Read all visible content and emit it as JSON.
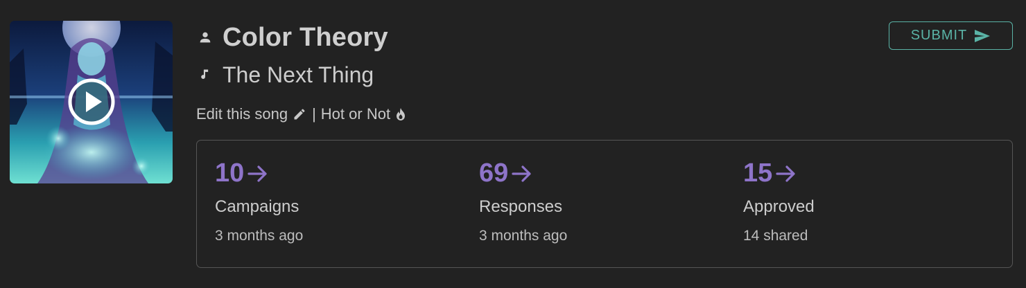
{
  "cover": {
    "alt_icon": "play-icon"
  },
  "artist": {
    "icon": "person-icon",
    "name": "Color Theory"
  },
  "song": {
    "icon": "music-note-icon",
    "title": "The Next Thing"
  },
  "links": {
    "edit_label": "Edit this song",
    "edit_icon": "pencil-icon",
    "separator": "|",
    "hot_label": "Hot or Not",
    "hot_icon": "flame-icon"
  },
  "submit": {
    "label": "SUBMIT",
    "icon": "send-icon"
  },
  "stats": [
    {
      "value": "10",
      "label": "Campaigns",
      "sub": "3 months ago"
    },
    {
      "value": "69",
      "label": "Responses",
      "sub": "3 months ago"
    },
    {
      "value": "15",
      "label": "Approved",
      "sub": "14 shared"
    }
  ],
  "colors": {
    "background": "#222222",
    "accent_purple": "#8e74c9",
    "accent_teal": "#5ab3a6",
    "border": "#565656"
  }
}
